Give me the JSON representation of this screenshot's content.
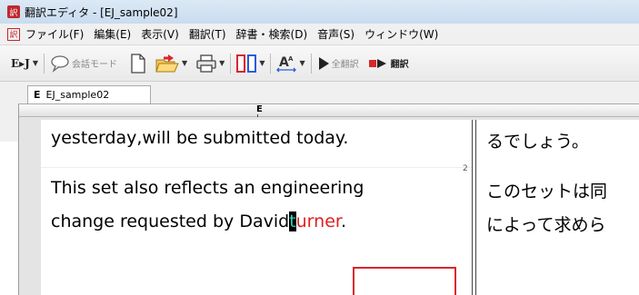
{
  "window": {
    "title": "翻訳エディタ - [EJ_sample02]",
    "app_icon_glyph": "訳"
  },
  "menu": {
    "icon_glyph": "訳",
    "items": [
      "ファイル(F)",
      "編集(E)",
      "表示(V)",
      "翻訳(T)",
      "辞書・検索(D)",
      "音声(S)",
      "ウィンドウ(W)"
    ]
  },
  "toolbar": {
    "direction_label": "E▸J",
    "conversation_mode_label": "会話モード",
    "translate_all_label": "全翻訳",
    "translate_label": "翻訳"
  },
  "tab": {
    "letter": "E",
    "name": "EJ_sample02"
  },
  "ruler": {
    "label": "E"
  },
  "document": {
    "line1_en": "yesterday,will be submitted today.",
    "line1_ja": "るでしょう。",
    "segment_number": "2",
    "line2_en": "This set also reflects an engineering",
    "line2_ja": "このセットは同",
    "line3_en_before": "change requested by Davi",
    "line3_en_hidden": "d",
    "line3_en_cursor": "t",
    "line3_en_red": "urner",
    "line3_en_after": ".",
    "line3_ja": "によって求めら"
  },
  "colors": {
    "highlight_red": "#d9262d",
    "cursor_text": "#2dd0c0"
  }
}
